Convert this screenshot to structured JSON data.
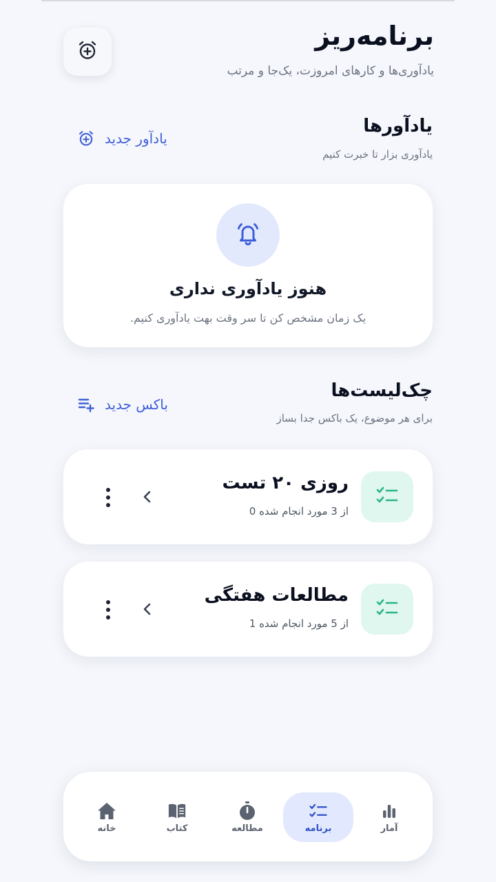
{
  "header": {
    "title": "برنامه‌ریز",
    "subtitle": "یادآوری‌ها و کارهای امروزت، یک‌جا و مرتب",
    "add_alarm_icon": "alarm-add-icon"
  },
  "reminders": {
    "title": "یادآورها",
    "subtitle": "یادآوری بزار تا خبرت کنیم",
    "new_label": "یادآور جدید",
    "empty_title": "هنوز یادآوری نداری",
    "empty_desc": ".یک زمان مشخص کن تا سر وقت بهت یادآوری کنیم"
  },
  "checklists": {
    "title": "چک‌لیست‌ها",
    "subtitle": "برای هر موضوع، یک باکس جدا بساز",
    "new_label": "باکس جدید",
    "items": [
      {
        "title": "روزی ۲۰ تست",
        "progress": "از 3 مورد انجام شده 0"
      },
      {
        "title": "مطالعات هفتگی",
        "progress": "از 5 مورد انجام شده 1"
      }
    ]
  },
  "nav": {
    "items": [
      {
        "label": "آمار",
        "icon": "stats-icon"
      },
      {
        "label": "برنامه",
        "icon": "checklist-icon",
        "active": true
      },
      {
        "label": "مطالعه",
        "icon": "stopwatch-icon"
      },
      {
        "label": "کتاب",
        "icon": "book-icon"
      },
      {
        "label": "خانه",
        "icon": "home-icon"
      }
    ]
  },
  "colors": {
    "accent": "#3e5fd8",
    "green": "#2bb389",
    "green_bg": "#dff7ee",
    "background": "#f5f7fc"
  }
}
